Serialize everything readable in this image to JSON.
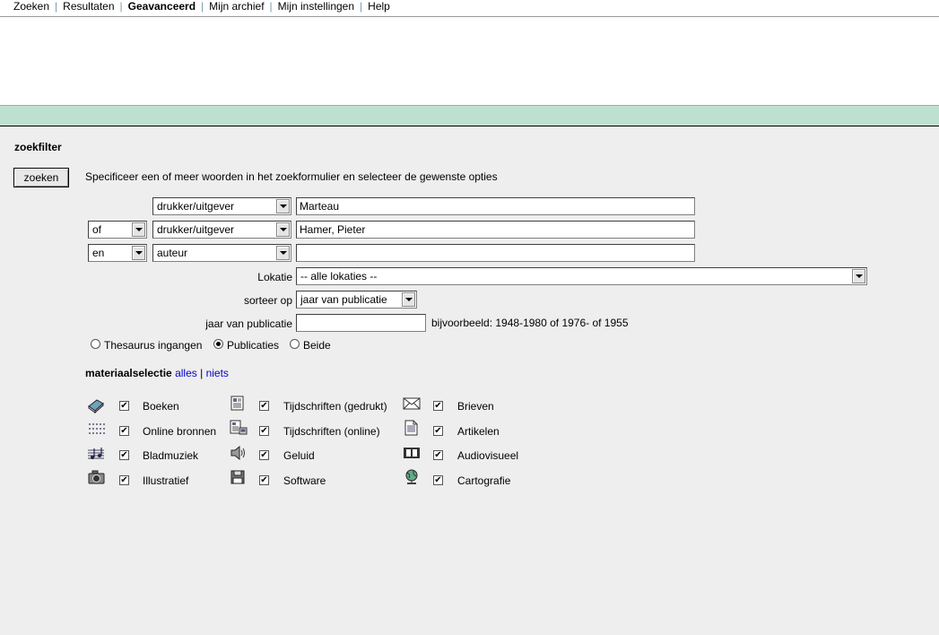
{
  "nav": {
    "items": [
      {
        "label": "Zoeken"
      },
      {
        "label": "Resultaten"
      },
      {
        "label": "Geavanceerd"
      },
      {
        "label": "Mijn archief"
      },
      {
        "label": "Mijn instellingen"
      },
      {
        "label": "Help"
      }
    ]
  },
  "filter": {
    "heading": "zoekfilter",
    "search_button": "zoeken",
    "instruction": "Specificeer een of meer woorden in het zoekformulier en selecteer de gewenste opties",
    "rows": [
      {
        "field": "drukker/uitgever",
        "value": "Marteau"
      },
      {
        "operator": "of",
        "field": "drukker/uitgever",
        "value": "Hamer, Pieter"
      },
      {
        "operator": "en",
        "field": "auteur",
        "value": ""
      }
    ],
    "location_label": "Lokatie",
    "location_value": "-- alle lokaties --",
    "sort_label": "sorteer op",
    "sort_value": "jaar van publicatie",
    "year_label": "jaar van publicatie",
    "year_value": "",
    "year_hint": "bijvoorbeeld: 1948-1980 of 1976- of 1955",
    "radio": {
      "options": [
        "Thesaurus ingangen",
        "Publicaties",
        "Beide"
      ],
      "selected": "Publicaties"
    }
  },
  "materials": {
    "heading": "materiaalselectie",
    "all_link": "alles",
    "separator": "|",
    "none_link": "niets",
    "items": [
      {
        "label": "Boeken",
        "icon": "book-icon",
        "checked": true
      },
      {
        "label": "Tijdschriften (gedrukt)",
        "icon": "journal-print-icon",
        "checked": true
      },
      {
        "label": "Brieven",
        "icon": "letter-icon",
        "checked": true
      },
      {
        "label": "Online bronnen",
        "icon": "online-resource-icon",
        "checked": true
      },
      {
        "label": "Tijdschriften (online)",
        "icon": "journal-online-icon",
        "checked": true
      },
      {
        "label": "Artikelen",
        "icon": "article-icon",
        "checked": true
      },
      {
        "label": "Bladmuziek",
        "icon": "sheet-music-icon",
        "checked": true
      },
      {
        "label": "Geluid",
        "icon": "speaker-icon",
        "checked": true
      },
      {
        "label": "Audiovisueel",
        "icon": "film-icon",
        "checked": true
      },
      {
        "label": "Illustratief",
        "icon": "camera-icon",
        "checked": true
      },
      {
        "label": "Software",
        "icon": "floppy-disk-icon",
        "checked": true
      },
      {
        "label": "Cartografie",
        "icon": "globe-icon",
        "checked": true
      }
    ]
  }
}
